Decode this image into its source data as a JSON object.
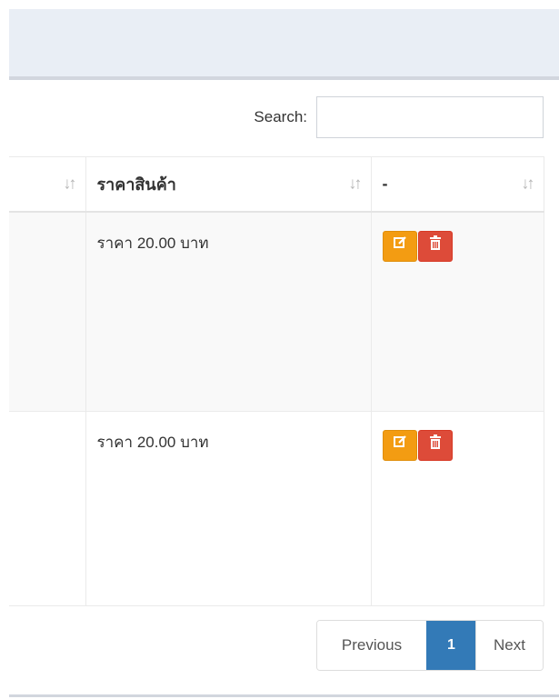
{
  "search": {
    "label": "Search:",
    "value": ""
  },
  "table": {
    "headers": [
      "",
      "ราคาสินค้า",
      "-"
    ],
    "sort_icon": "sort-both-icon",
    "rows": [
      {
        "price": "ราคา 20.00 บาท"
      },
      {
        "price": "ราคา 20.00 บาท"
      }
    ],
    "edit_icon": "edit-icon",
    "delete_icon": "trash-icon"
  },
  "pagination": {
    "previous": "Previous",
    "current": "1",
    "next": "Next"
  },
  "colors": {
    "edit": "#f39c12",
    "delete": "#dd4b39",
    "active_page": "#337ab7"
  }
}
